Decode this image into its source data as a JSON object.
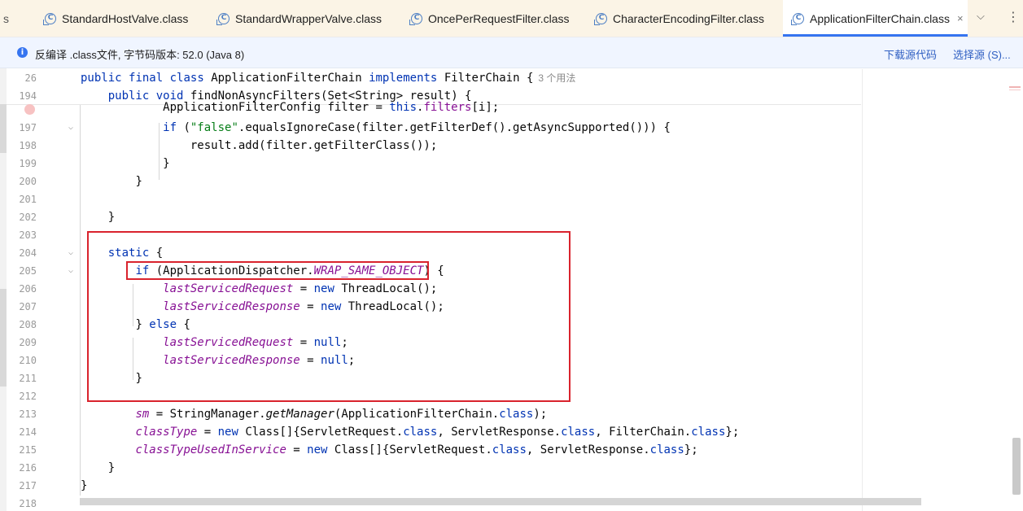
{
  "tabs": [
    {
      "label": "s",
      "active": false
    },
    {
      "label": "StandardHostValve.class",
      "active": false
    },
    {
      "label": "StandardWrapperValve.class",
      "active": false
    },
    {
      "label": "OncePerRequestFilter.class",
      "active": false
    },
    {
      "label": "CharacterEncodingFilter.class",
      "active": false
    },
    {
      "label": "ApplicationFilterChain.class",
      "active": true
    }
  ],
  "tab_icon_letter": "C",
  "tab_close_glyph": "×",
  "tab_dropdown_glyph": "⌵",
  "tab_more_glyph": "⋮",
  "notice": {
    "icon_glyph": "i",
    "text": "反编译 .class文件, 字节码版本: 52.0 (Java 8)",
    "download_link": "下载源代码",
    "choose_link": "选择源 (S)..."
  },
  "usage_hint": "3 个用法",
  "lines": [
    {
      "n": "26"
    },
    {
      "n": "194"
    },
    {
      "n": ""
    },
    {
      "n": "197"
    },
    {
      "n": "198"
    },
    {
      "n": "199"
    },
    {
      "n": "200"
    },
    {
      "n": "201"
    },
    {
      "n": "202"
    },
    {
      "n": "203"
    },
    {
      "n": "204"
    },
    {
      "n": "205"
    },
    {
      "n": "206"
    },
    {
      "n": "207"
    },
    {
      "n": "208"
    },
    {
      "n": "209"
    },
    {
      "n": "210"
    },
    {
      "n": "211"
    },
    {
      "n": "212"
    },
    {
      "n": "213"
    },
    {
      "n": "214"
    },
    {
      "n": "215"
    },
    {
      "n": "216"
    },
    {
      "n": "217"
    },
    {
      "n": "218"
    }
  ],
  "fold_glyph": "⌵",
  "t": {
    "kw_public": "public",
    "kw_final": "final",
    "kw_class": "class",
    "kw_implements": "implements",
    "kw_void": "void",
    "kw_this": "this",
    "kw_if": "if",
    "kw_else": "else",
    "kw_static": "static",
    "kw_new": "new",
    "kw_null": "null",
    "kw_dotclass": "class",
    "cls_name": "ApplicationFilterChain",
    "iface": "FilterChain",
    "brace_open": "{",
    "brace_close": "}",
    "method_find": "findNonAsyncFilters",
    "param_sig": "(Set<String> result) {",
    "afc_type": "ApplicationFilterConfig filter = ",
    "filters_field": "filters",
    "filters_idx": "[i];",
    "if_open": " (",
    "str_false": "\"false\"",
    "equals_call": ".equalsIgnoreCase(filter.getFilterDef().getAsyncSupported())) {",
    "result_add": "result.add(filter.getFilterClass());",
    "if_dispatch_a": " (ApplicationDispatcher.",
    "wrap_same": "WRAP_SAME_OBJECT",
    "if_dispatch_b": ") {",
    "last_req": "lastServicedRequest",
    "last_resp": "lastServicedResponse",
    "assign": " = ",
    "threadlocal": " ThreadLocal();",
    "semicolon": ";",
    "else_close": "} ",
    "else_open": " {",
    "sm": "sm",
    "sm_rhs": " = StringManager.",
    "get_manager": "getManager",
    "sm_args": "(ApplicationFilterChain.",
    "sm_end": ");",
    "class_type": "classType",
    "class_arr_a": " Class[]{ServletRequest.",
    "class_arr_b": ", ServletResponse.",
    "class_arr_c": ", FilterChain.",
    "class_arr_end": "};",
    "class_type_svc": "classTypeUsedInService"
  }
}
